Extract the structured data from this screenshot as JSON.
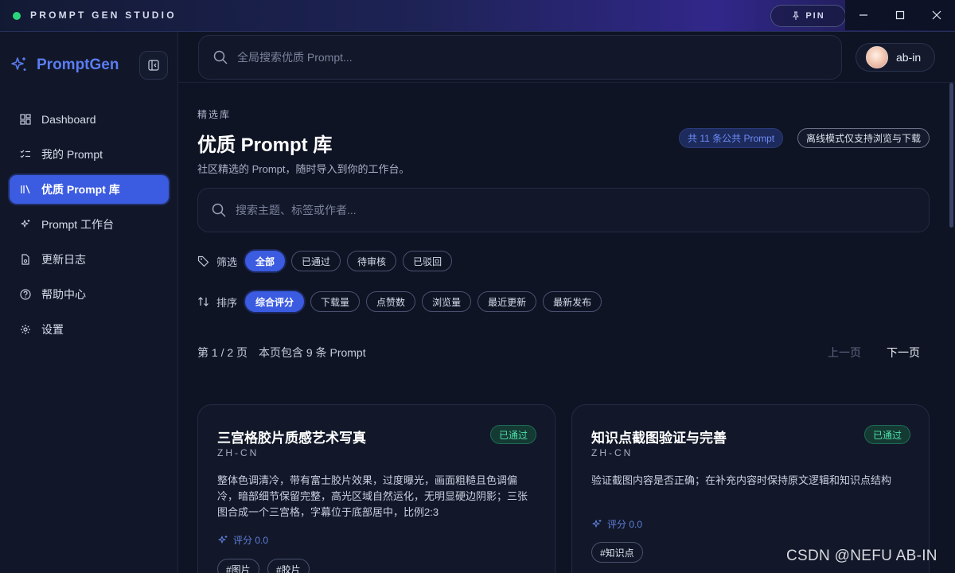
{
  "titlebar": {
    "app_name": "PROMPT GEN STUDIO",
    "pin_label": "PIN",
    "status_color": "#2bd47a"
  },
  "sidebar": {
    "brand": "PromptGen",
    "items": [
      {
        "label": "Dashboard",
        "icon": "dashboard-icon"
      },
      {
        "label": "我的 Prompt",
        "icon": "list-check-icon"
      },
      {
        "label": "优质 Prompt 库",
        "icon": "library-icon",
        "active": true
      },
      {
        "label": "Prompt 工作台",
        "icon": "sparkles-icon"
      },
      {
        "label": "更新日志",
        "icon": "document-icon"
      },
      {
        "label": "帮助中心",
        "icon": "help-circle-icon"
      },
      {
        "label": "设置",
        "icon": "gear-icon"
      }
    ]
  },
  "header": {
    "search_placeholder": "全局搜索优质 Prompt...",
    "user_name": "ab-in"
  },
  "main": {
    "eyebrow": "精选库",
    "title": "优质 Prompt 库",
    "subtitle": "社区精选的 Prompt，随时导入到你的工作台。",
    "count_badge": "共 11 条公共 Prompt",
    "offline_badge": "离线模式仅支持浏览与下载",
    "search_placeholder": "搜索主题、标签或作者...",
    "filter": {
      "label": "筛选",
      "options": [
        "全部",
        "已通过",
        "待审核",
        "已驳回"
      ],
      "selected": "全部"
    },
    "sort": {
      "label": "排序",
      "options": [
        "综合评分",
        "下载量",
        "点赞数",
        "浏览量",
        "最近更新",
        "最新发布"
      ],
      "selected": "综合评分"
    },
    "pager": {
      "page_text": "第 1 / 2 页",
      "count_text": "本页包含 9 条 Prompt",
      "prev": "上一页",
      "next": "下一页"
    },
    "cards": [
      {
        "title": "三宫格胶片质感艺术写真",
        "lang": "ZH-CN",
        "status": "已通过",
        "description": "整体色调清冷，带有富士胶片效果，过度曝光，画面粗糙且色调偏冷，暗部细节保留完整，高光区域自然运化，无明显硬边阴影；三张图合成一个三宫格，字幕位于底部居中，比例2:3",
        "rating": "评分 0.0",
        "tags": [
          "#图片",
          "#胶片"
        ]
      },
      {
        "title": "知识点截图验证与完善",
        "lang": "ZH-CN",
        "status": "已通过",
        "description": "验证截图内容是否正确；在补充内容时保持原文逻辑和知识点结构",
        "rating": "评分 0.0",
        "tags": [
          "#知识点"
        ]
      }
    ]
  },
  "watermark": "CSDN @NEFU AB-IN",
  "colors": {
    "accent": "#3b5be0",
    "brand": "#5b7cf2",
    "background": "#0f1424",
    "success": "#4fe0a8"
  }
}
